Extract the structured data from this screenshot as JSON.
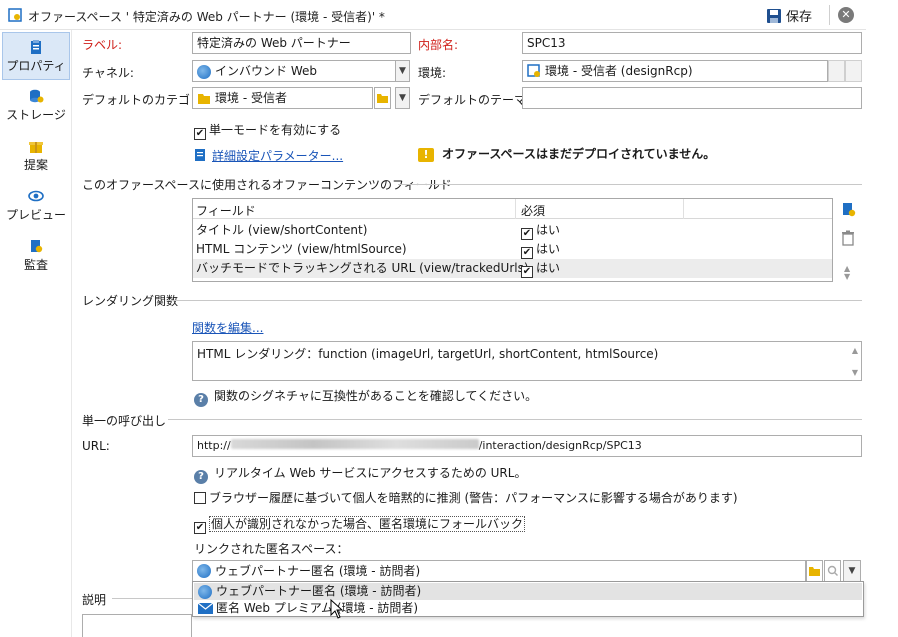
{
  "window": {
    "title": "オファースペース ' 特定済みの Web パートナー (環境 - 受信者)' *",
    "save_label": "保存",
    "close_label": "✕"
  },
  "sidebar": {
    "items": [
      {
        "label": "プロパティ",
        "icon": "properties-icon",
        "active": true
      },
      {
        "label": "ストレージ",
        "icon": "storage-icon",
        "active": false
      },
      {
        "label": "提案",
        "icon": "proposition-icon",
        "active": false
      },
      {
        "label": "プレビュー",
        "icon": "preview-icon",
        "active": false
      },
      {
        "label": "監査",
        "icon": "audit-icon",
        "active": false
      }
    ]
  },
  "form": {
    "label_label": "ラベル:",
    "label_value": "特定済みの Web パートナー",
    "internal_name_label": "内部名:",
    "internal_name_value": "SPC13",
    "channel_label": "チャネル:",
    "channel_value": "インバウンド Web",
    "environment_label": "環境:",
    "environment_value": "環境 - 受信者 (designRcp)",
    "default_category_label": "デフォルトのカテゴリ:",
    "default_category_value": "環境 - 受信者",
    "default_theme_label": "デフォルトのテーマ:",
    "default_theme_value": "",
    "single_mode_label": "単一モードを有効にする",
    "single_mode_checked": true,
    "advanced_params_link": "詳細設定パラメーター...",
    "not_deployed_warning": "オファースペースはまだデプロイされていません。"
  },
  "fields_section": {
    "title": "このオファースペースに使用されるオファーコンテンツのフィールド",
    "columns": [
      "フィールド",
      "必須"
    ],
    "rows": [
      {
        "field": "タイトル (view/shortContent)",
        "required": "はい",
        "checked": true
      },
      {
        "field": "HTML コンテンツ (view/htmlSource)",
        "required": "はい",
        "checked": true
      },
      {
        "field": "バッチモードでトラッキングされる URL (view/trackedUrls)",
        "required": "はい",
        "checked": true
      }
    ]
  },
  "rendering_section": {
    "title": "レンダリング関数",
    "edit_link": "関数を編集...",
    "function_text": "HTML レンダリング：function (imageUrl, targetUrl, shortContent, htmlSource)",
    "hint": "関数のシグネチャに互換性があることを確認してください。"
  },
  "single_call_section": {
    "title": "単一の呼び出し",
    "url_label": "URL:",
    "url_prefix": "http://",
    "url_suffix": "/interaction/designRcp/SPC13",
    "url_hint": "リアルタイム Web サービスにアクセスするための URL。",
    "implicit_label": "ブラウザー履歴に基づいて個人を暗黙的に推測 (警告：パフォーマンスに影響する場合があります)",
    "implicit_checked": false,
    "fallback_label": "個人が識別されなかった場合、匿名環境にフォールバック",
    "fallback_checked": true,
    "linked_anon_label": "リンクされた匿名スペース：",
    "linked_anon_value": "ウェブパートナー匿名 (環境 - 訪問者)",
    "dropdown_options": [
      "ウェブパートナー匿名 (環境 - 訪問者)",
      "匿名 Web プレミアム (環境 - 訪問者)"
    ]
  },
  "description_section": {
    "title": "説明"
  },
  "colors": {
    "accent": "#1a55b8",
    "required_label": "#d0201a",
    "sidebar_active": "#dbe8f7",
    "warning": "#e8b400"
  }
}
